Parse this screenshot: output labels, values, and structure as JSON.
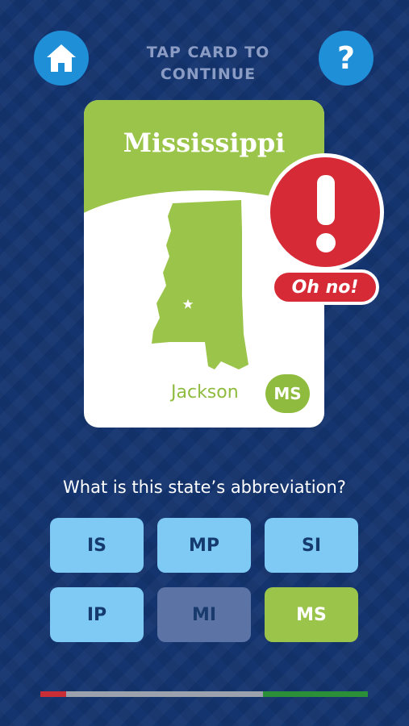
{
  "header": {
    "instruction_line1": "TAP CARD TO",
    "instruction_line2": "CONTINUE",
    "home_icon": "home-icon",
    "help_icon": "question-mark-icon",
    "help_label": "?"
  },
  "card": {
    "state_name": "Mississippi",
    "capital": "Jackson",
    "abbreviation": "MS",
    "capital_marker_icon": "star-icon"
  },
  "feedback": {
    "icon": "exclamation-icon",
    "label": "Oh no!"
  },
  "question": "What is this state’s abbreviation?",
  "answers": [
    {
      "label": "IS",
      "state": "default"
    },
    {
      "label": "MP",
      "state": "default"
    },
    {
      "label": "SI",
      "state": "default"
    },
    {
      "label": "IP",
      "state": "default"
    },
    {
      "label": "MI",
      "state": "wrong"
    },
    {
      "label": "MS",
      "state": "correct"
    }
  ],
  "progress": {
    "wrong_fraction": 0.08,
    "pending_fraction": 0.6,
    "correct_fraction": 0.32
  },
  "colors": {
    "background": "#14346f",
    "accent_blue": "#1f8fd8",
    "card_green": "#9bc44a",
    "alert_red": "#d62a36",
    "answer_default": "#7fcaf5",
    "answer_wrong": "#5c73a5",
    "answer_correct": "#9bc44a"
  }
}
